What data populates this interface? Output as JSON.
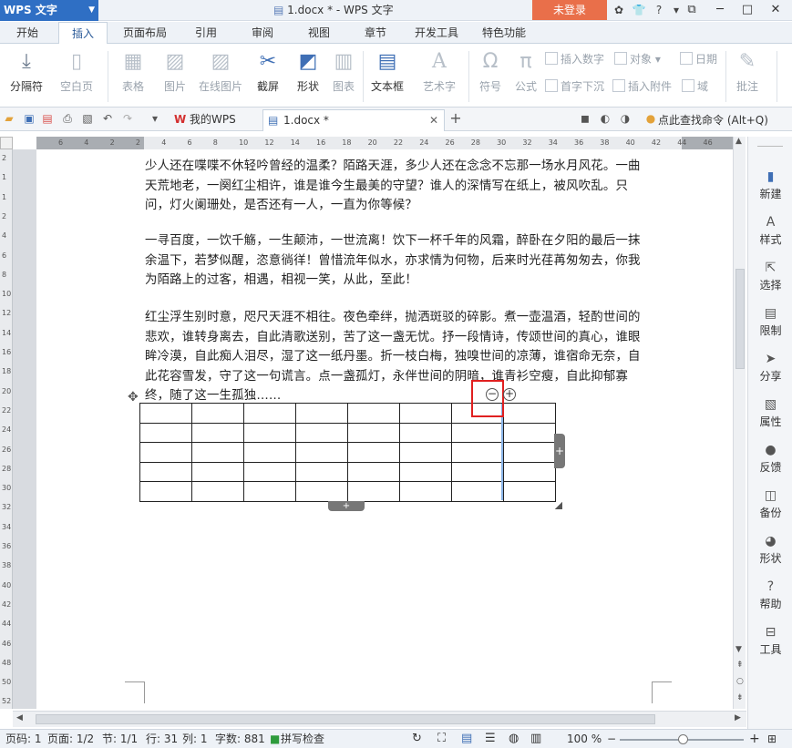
{
  "app": {
    "name": "WPS 文字",
    "window_title": "1.docx * - WPS 文字",
    "login": "未登录"
  },
  "menu": [
    "开始",
    "插入",
    "页面布局",
    "引用",
    "审阅",
    "视图",
    "章节",
    "开发工具",
    "特色功能"
  ],
  "active_menu": "插入",
  "ribbon": {
    "big": [
      "分隔符",
      "空白页",
      "表格",
      "图片",
      "在线图片",
      "截屏",
      "形状",
      "图表",
      "文本框",
      "艺术字",
      "符号",
      "公式",
      "批注"
    ],
    "small": [
      "插入数字",
      "对象",
      "日期",
      "首字下沉",
      "插入附件",
      "域"
    ]
  },
  "tabs": {
    "home": "我的WPS",
    "doc": "1.docx *",
    "search": "点此查找命令 (Alt+Q)"
  },
  "ruler": {
    "h": [
      "6",
      "4",
      "2",
      "2",
      "4",
      "6",
      "8",
      "10",
      "12",
      "14",
      "16",
      "18",
      "20",
      "22",
      "24",
      "26",
      "28",
      "30",
      "32",
      "34",
      "36",
      "38",
      "40",
      "42",
      "44",
      "46"
    ],
    "v": [
      "2",
      "1",
      "1",
      "2",
      "4",
      "6",
      "8",
      "10",
      "12",
      "14",
      "16",
      "18",
      "20",
      "22",
      "24",
      "26",
      "28",
      "30",
      "32",
      "34",
      "36",
      "38",
      "40",
      "42",
      "44",
      "46",
      "48",
      "50",
      "52"
    ]
  },
  "document": {
    "paragraphs": [
      "少人还在喋喋不休轻吟曾经的温柔？陌路天涯，多少人还在念念不忘那一场水月风花。一曲天荒地老，一阕红尘相许，谁是谁今生最美的守望？谁人的深情写在纸上，被风吹乱。只问，灯火阑珊处，是否还有一人，一直为你等候？",
      "一寻百度，一饮千觞，一生颠沛，一世流离！饮下一杯千年的风霜，醉卧在夕阳的最后一抹余温下，若梦似醒，恣意徜徉！曾惜流年似水，亦求情为何物，后来时光荏苒匆匆去，你我为陌路上的过客，相遇，相视一笑，从此，至此！",
      "红尘浮生别时意，咫尺天涯不相往。夜色牵绊，抛洒斑驳的碎影。煮一壶温酒，轻酌世间的悲欢，谁转身离去，自此清歌送别，苦了这一盏无忧。抒一段情诗，传颂世间的真心，谁眼眸冷漠，自此痴人泪尽，湿了这一纸丹墨。折一枝白梅，独嗅世间的凉薄，谁宿命无奈，自此花容雪发，守了这一句谎言。点一盏孤灯，永伴世间的阴暗，谁青衫空瘦，自此抑郁寡终，随了这一生孤独……"
    ],
    "table": {
      "rows": 5,
      "cols": 8
    }
  },
  "right_panel": [
    "新建",
    "样式",
    "选择",
    "限制",
    "分享",
    "属性",
    "反馈",
    "备份",
    "形状",
    "帮助",
    "工具"
  ],
  "status": {
    "page_code": "页码: 1",
    "page": "页面: 1/2",
    "section": "节: 1/1",
    "row": "行: 31",
    "col": "列: 1",
    "chars": "字数: 881",
    "spell": "拼写检查",
    "zoom": "100 %"
  },
  "colors": {
    "accent": "#2f6fc4",
    "login": "#e96f4a",
    "highlight": "#e02020"
  }
}
